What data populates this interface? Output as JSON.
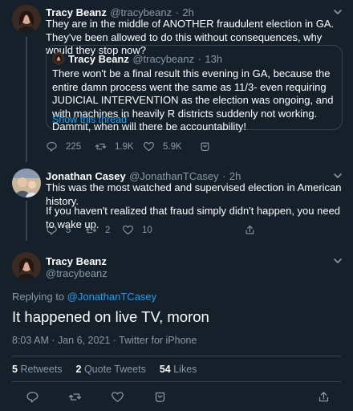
{
  "tweet1": {
    "name": "Tracy Beanz",
    "handle": "@tracybeanz",
    "dot": "·",
    "time": "2h",
    "text": "They are in the middle of ANOTHER fraudulent election in GA. They've been allowed to do this without consequences, why would they stop now?",
    "quote": {
      "name": "Tracy Beanz",
      "handle": "@tracybeanz",
      "dot": "·",
      "time": "13h",
      "text": "There won't be a final result this evening in GA, because the entire damn process went the same as 11/3- even requiring JUDICIAL INTERVENTION as the election was ongoing, and with machines in heavily R districts suddenly not working. Dammit, when will there be accountability!",
      "show_thread": "Show this thread"
    },
    "replies": "225",
    "retweets": "1.9K",
    "likes": "5.9K"
  },
  "tweet2": {
    "name": "Jonathan Casey",
    "handle": "@JonathanTCasey",
    "dot": "·",
    "time": "2h",
    "text1": "This was the most watched and supervised election in American history.",
    "text2": "If you haven't realized that fraud simply didn't happen, you need to wake up.",
    "replies": "5",
    "retweets": "2",
    "likes": "10"
  },
  "main_tweet": {
    "name": "Tracy Beanz",
    "handle": "@tracybeanz",
    "replying_prefix": "Replying to",
    "replying_to": "@JonathanTCasey",
    "text": "It happened on live TV, moron",
    "timestamp": "8:03 AM · Jan 6, 2021 · Twitter for iPhone",
    "stats": {
      "retweets_count": "5",
      "retweets_label": "Retweets",
      "quotes_count": "2",
      "quotes_label": "Quote Tweets",
      "likes_count": "54",
      "likes_label": "Likes"
    }
  },
  "colors": {
    "background": "#15202b",
    "secondary_text": "#8899a6",
    "link": "#1da1f2",
    "border": "#38444d"
  },
  "icons": [
    "reply-icon",
    "retweet-icon",
    "like-icon",
    "share-icon",
    "more-chevron-icon"
  ]
}
